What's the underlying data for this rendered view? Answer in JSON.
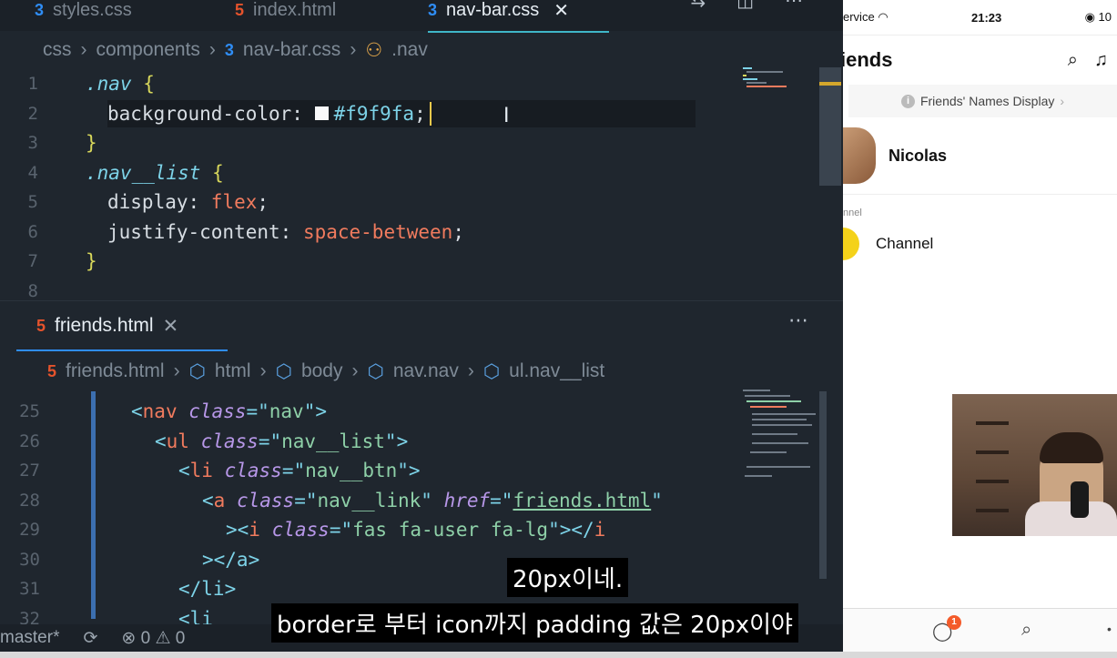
{
  "editor": {
    "tabs": [
      {
        "label": "styles.css",
        "kind": "css"
      },
      {
        "label": "index.html",
        "kind": "html"
      },
      {
        "label": "nav-bar.css",
        "kind": "css",
        "active": true
      }
    ],
    "breadcrumb_top": [
      "css",
      "components",
      "nav-bar.css",
      ".nav"
    ],
    "css_lines": [
      {
        "n": "1"
      },
      {
        "n": "2"
      },
      {
        "n": "3"
      },
      {
        "n": "4"
      },
      {
        "n": "5"
      },
      {
        "n": "6"
      },
      {
        "n": "7"
      },
      {
        "n": "8"
      }
    ],
    "css_text": {
      "l1_sel": ".nav",
      "l1_brace": "{",
      "l2_prop": "background-color: ",
      "l2_val": "#f9f9fa",
      "l2_semi": ";",
      "l3_brace": "}",
      "l4_sel": ".nav__list",
      "l4_brace": "{",
      "l5_prop": "display: ",
      "l5_val": "flex",
      "l5_semi": ";",
      "l6_prop": "justify-content: ",
      "l6_val": "space-between",
      "l6_semi": ";",
      "l7_brace": "}"
    },
    "second_tab": "friends.html",
    "breadcrumb_bottom": [
      "friends.html",
      "html",
      "body",
      "nav.nav",
      "ul.nav__list"
    ],
    "html_lines": [
      "25",
      "26",
      "27",
      "28",
      "29",
      "30",
      "31",
      "32"
    ],
    "html_text": {
      "l25": [
        "<",
        "nav",
        " ",
        "class",
        "=\"",
        "nav",
        "\">"
      ],
      "l26": [
        "<",
        "ul",
        " ",
        "class",
        "=\"",
        "nav__list",
        "\">"
      ],
      "l27": [
        "<",
        "li",
        " ",
        "class",
        "=\"",
        "nav__btn",
        "\">"
      ],
      "l28a": [
        "<",
        "a",
        " ",
        "class",
        "=\"",
        "nav__link",
        "\" ",
        "href",
        "=\"",
        "friends.html",
        "\""
      ],
      "l29": [
        "><",
        "i",
        " ",
        "class",
        "=\"",
        "fas fa-user fa-lg",
        "\"></",
        "i"
      ],
      "l30": "></a>",
      "l31": "</li>",
      "l32": "<li"
    },
    "status": {
      "branch": "master*",
      "errors": "0",
      "warnings": "0"
    }
  },
  "phone": {
    "carrier": "ervice",
    "time": "21:23",
    "battery": "10",
    "title": "iends",
    "names_display": "Friends' Names Display",
    "profile_name": "Nicolas",
    "channel_section": "nnel",
    "channel_name": "Channel",
    "badge_count": "1"
  },
  "subtitles": {
    "line1": "20px이네.",
    "line2": "border로 부터 icon까지 padding 값은 20px이야"
  },
  "colors": {
    "accent": "#3fb6c8",
    "swatch": "#f9f9fa",
    "badge": "#f45b2a"
  }
}
